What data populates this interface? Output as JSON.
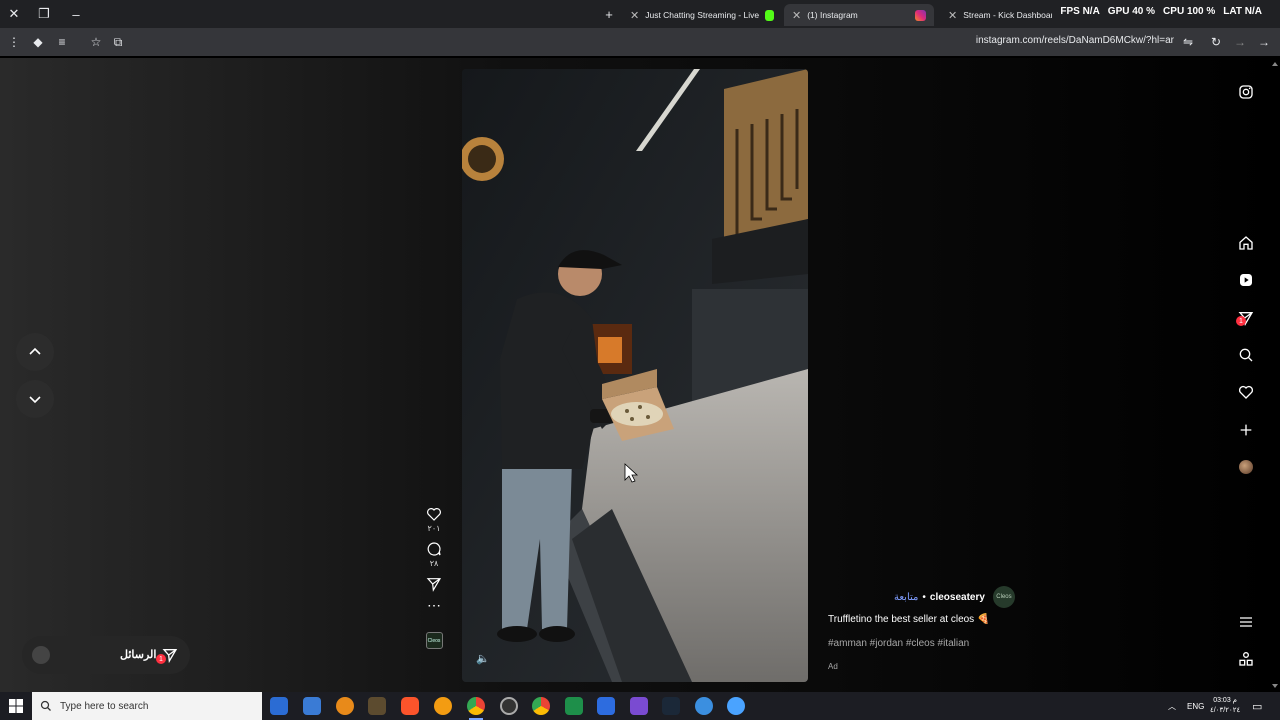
{
  "browser": {
    "tabs": [
      {
        "label": "Just Chatting Streaming - Live",
        "active": false,
        "favicon_color": "#53fc18"
      },
      {
        "label": "(1) Instagram",
        "active": true,
        "favicon_color": "#e1306c"
      },
      {
        "label": "Stream - Kick Dashboard",
        "active": false,
        "favicon_color": "#53fc18"
      }
    ],
    "hud": [
      "FPS N/A",
      "GPU 40 %",
      "CPU 100 %",
      "LAT N/A"
    ],
    "url": "instagram.com/reels/DaNamD6MCkw/?hl=ar"
  },
  "reel": {
    "likes": "٢٠١",
    "comments": "٢٨",
    "username": "cleoseatery",
    "follow_label": "متابعة",
    "separator": "•",
    "logo_text": "Cleos",
    "caption": "Truffletino the best seller at cleos 🍕",
    "hashtags": "#amman #jordan #cleos #italian",
    "ad_label": "Ad",
    "thumb_text": "Cleos"
  },
  "messages": {
    "label": "الرسائل",
    "badge": "1"
  },
  "sidebar": {
    "notification_count": "1"
  },
  "taskbar": {
    "search_placeholder": "Type here to search",
    "lang": "ENG",
    "time": "03:03 م",
    "date": "٤/٠٣/٢٠٢٤"
  },
  "colors": {
    "accent_follow": "#7f9dff",
    "notification": "#ff3040"
  }
}
